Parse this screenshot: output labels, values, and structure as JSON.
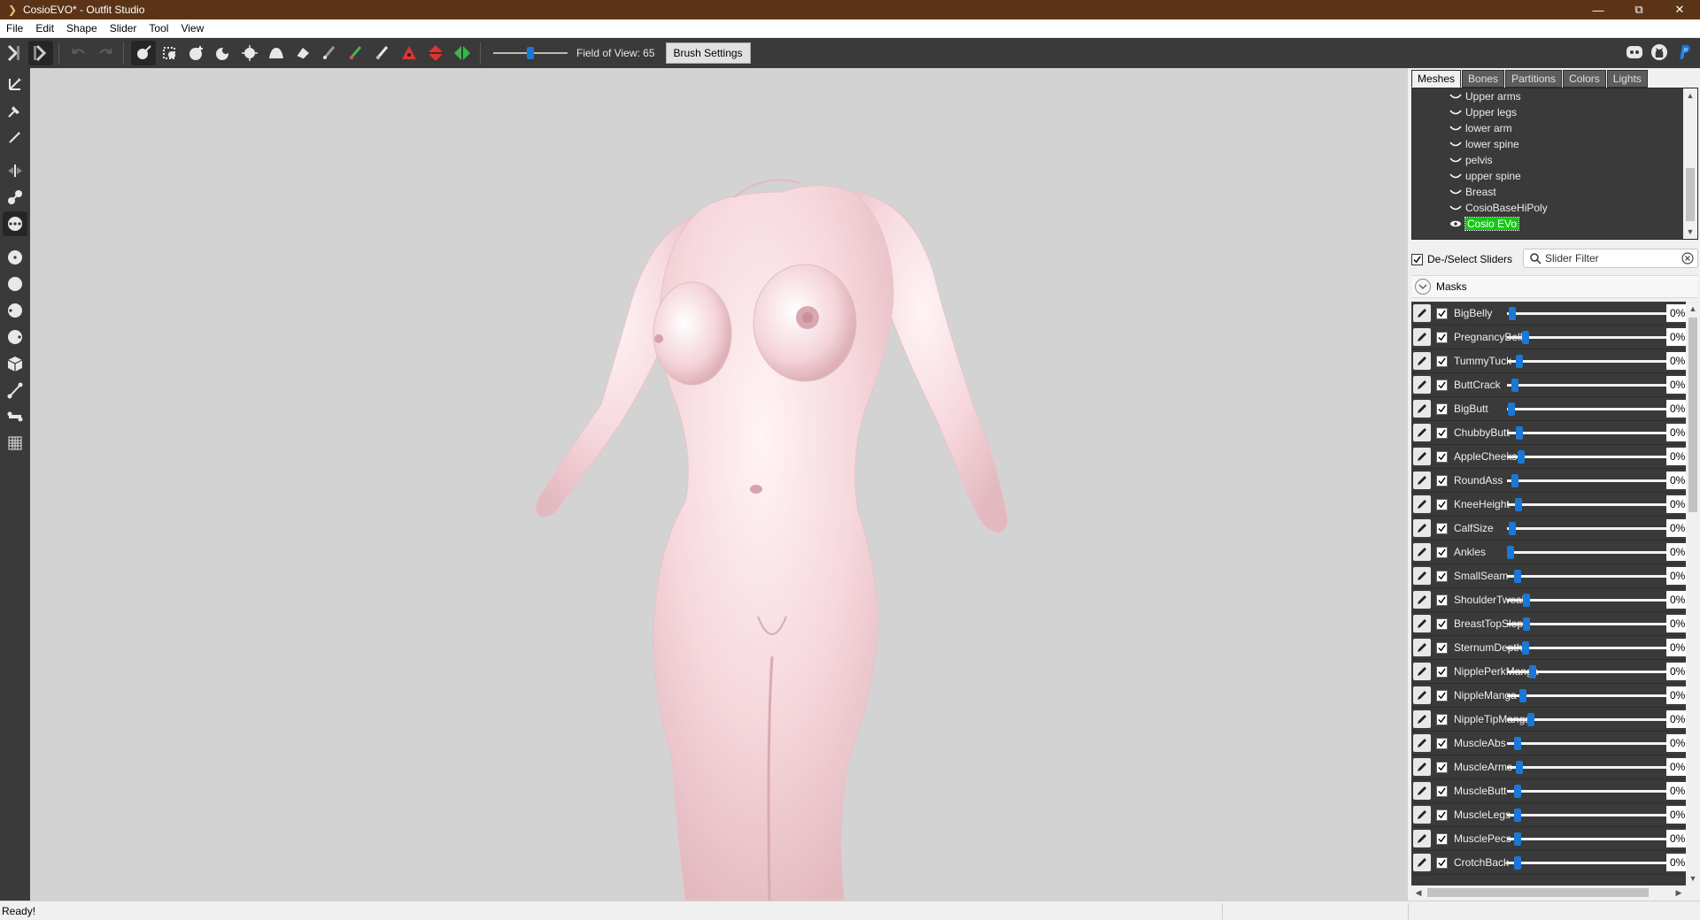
{
  "window": {
    "title": "CosioEVO* - Outfit Studio"
  },
  "menu": [
    "File",
    "Edit",
    "Shape",
    "Slider",
    "Tool",
    "View"
  ],
  "toolbar": {
    "fov_label": "Field of View: 65",
    "fov_value": 65,
    "brush_settings_label": "Brush Settings"
  },
  "tabs": [
    "Meshes",
    "Bones",
    "Partitions",
    "Colors",
    "Lights"
  ],
  "meshes": [
    "Upper arms",
    "Upper legs",
    "lower arm",
    "lower spine",
    "pelvis",
    "upper spine",
    "Breast",
    "CosioBaseHiPoly",
    "Cosio EVo"
  ],
  "selected_mesh": "Cosio EVo",
  "slider_panel": {
    "deselect_label": "De-/Select Sliders",
    "filter_placeholder": "Slider Filter",
    "masks_label": "Masks"
  },
  "sliders": [
    {
      "name": "BigBelly",
      "value": "0%"
    },
    {
      "name": "PregnancyBelly",
      "value": "0%"
    },
    {
      "name": "TummyTuck",
      "value": "0%"
    },
    {
      "name": "ButtCrack",
      "value": "0%"
    },
    {
      "name": "BigButt",
      "value": "0%"
    },
    {
      "name": "ChubbyButt",
      "value": "0%"
    },
    {
      "name": "AppleCheeks",
      "value": "0%"
    },
    {
      "name": "RoundAss",
      "value": "0%"
    },
    {
      "name": "KneeHeight",
      "value": "0%"
    },
    {
      "name": "CalfSize",
      "value": "0%"
    },
    {
      "name": "Ankles",
      "value": "0%"
    },
    {
      "name": "SmallSeam",
      "value": "0%"
    },
    {
      "name": "ShoulderTweak",
      "value": "0%"
    },
    {
      "name": "BreastTopSlope",
      "value": "0%"
    },
    {
      "name": "SternumDepth",
      "value": "0%"
    },
    {
      "name": "NipplePerkManga",
      "value": "0%"
    },
    {
      "name": "NippleManga",
      "value": "0%"
    },
    {
      "name": "NippleTipManga",
      "value": "0%"
    },
    {
      "name": "MuscleAbs",
      "value": "0%"
    },
    {
      "name": "MuscleArms",
      "value": "0%"
    },
    {
      "name": "MuscleButt",
      "value": "0%"
    },
    {
      "name": "MuscleLegs",
      "value": "0%"
    },
    {
      "name": "MusclePecs",
      "value": "0%"
    },
    {
      "name": "CrotchBack",
      "value": "0%"
    }
  ],
  "status": {
    "text": "Ready!"
  },
  "colors": {
    "titlebar": "#5b3417",
    "accent": "#1a78d6",
    "selected_mesh": "#12c912",
    "toolbar": "#3a3a3a",
    "viewport": "#d3d3d3",
    "model": "#f5d6db"
  }
}
